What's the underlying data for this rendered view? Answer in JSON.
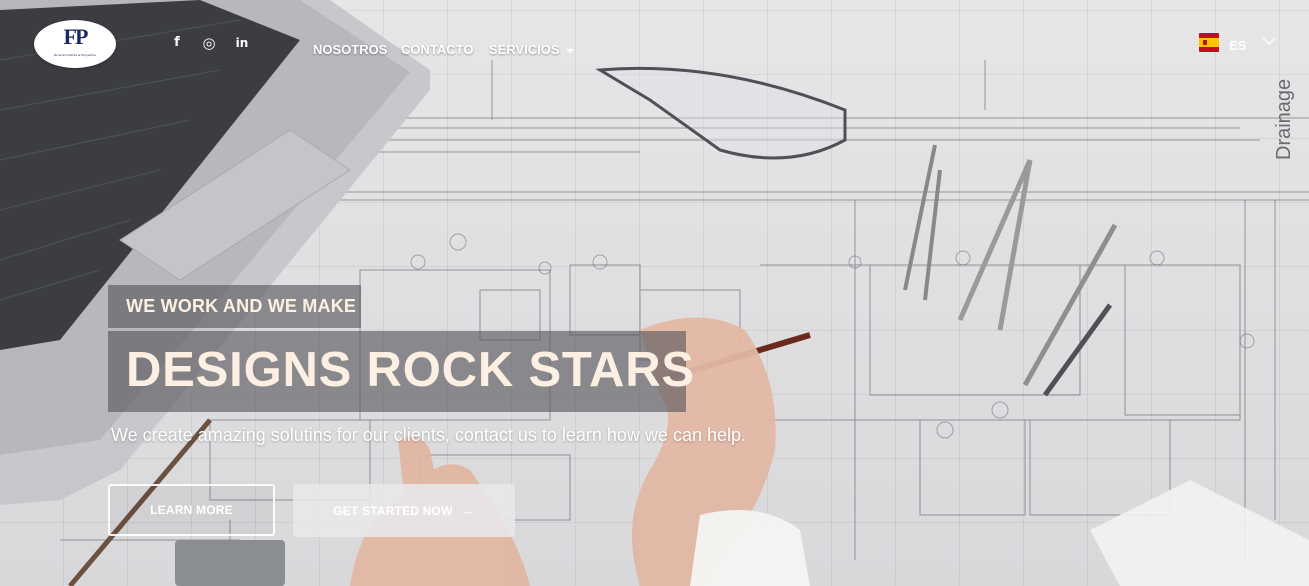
{
  "header": {
    "logo": {
      "mark": "FP",
      "sub": "Ricardo Infanta & Proyectos"
    },
    "social": [
      {
        "icon": "facebook-icon",
        "glyph": "f"
      },
      {
        "icon": "instagram-icon",
        "glyph": "◎"
      },
      {
        "icon": "linkedin-icon",
        "glyph": "in"
      }
    ],
    "nav": {
      "nosotros": "NOSOTROS",
      "contacto": "CONTACTO",
      "servicios": "SERVICIOS"
    },
    "language": {
      "code": "ES",
      "flag": "spain-flag-icon"
    }
  },
  "hero": {
    "eyebrow": "WE WORK AND WE MAKE",
    "headline": "DESIGNS ROCK STARS",
    "subtitle": "We create amazing solutins for our clients, contact us to learn how we can help.",
    "learn_more": "LEARN MORE",
    "get_started": "GET STARTED NOW",
    "get_started_icon": "→"
  },
  "colors": {
    "headline_text": "#fdf0e2",
    "logo_navy": "#1c2a63",
    "overlay": "#55555a"
  }
}
